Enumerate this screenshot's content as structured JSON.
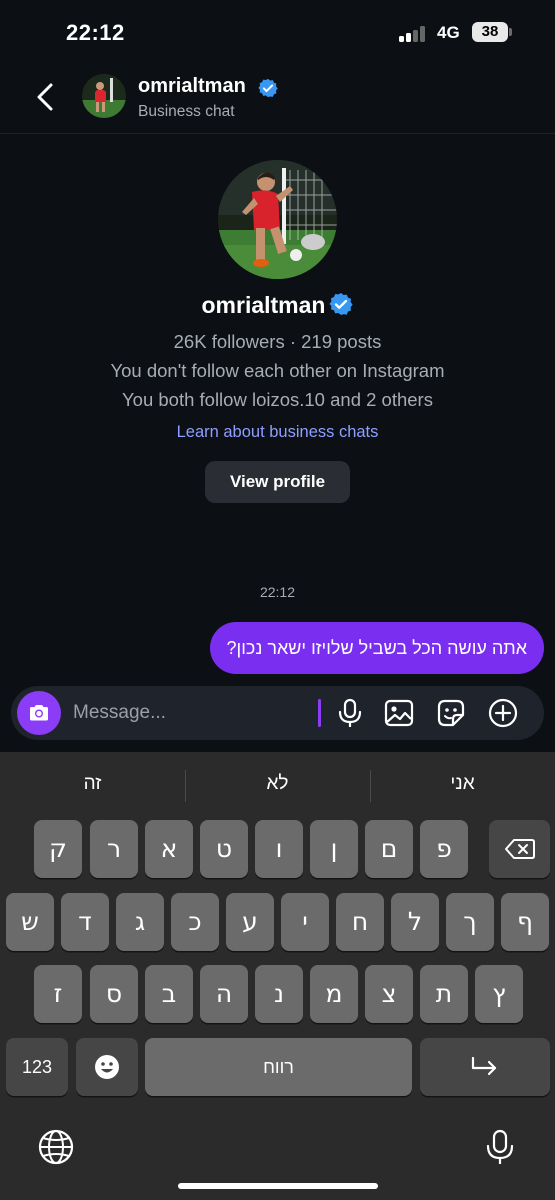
{
  "status_bar": {
    "time": "22:12",
    "network": "4G",
    "battery": "38"
  },
  "header": {
    "username": "omrialtman",
    "subtitle": "Business chat"
  },
  "profile": {
    "username": "omrialtman",
    "stats": "26K followers · 219 posts",
    "follow_status": "You don't follow each other on Instagram",
    "mutual": "You both follow loizos.10 and 2 others",
    "learn_link": "Learn about business chats",
    "view_profile_label": "View profile"
  },
  "messages": [
    {
      "time": "22:12",
      "text": "אתה עושה הכל בשביל שלויזו ישאר נכון?",
      "direction": "outgoing"
    }
  ],
  "composer": {
    "placeholder": "Message..."
  },
  "keyboard": {
    "suggestions": [
      "זה",
      "לא",
      "אני"
    ],
    "row1": [
      "ק",
      "ר",
      "א",
      "ט",
      "ו",
      "ן",
      "ם",
      "פ"
    ],
    "row2": [
      "ש",
      "ד",
      "ג",
      "כ",
      "ע",
      "י",
      "ח",
      "ל",
      "ך",
      "ף"
    ],
    "row3": [
      "ז",
      "ס",
      "ב",
      "ה",
      "נ",
      "מ",
      "צ",
      "ת",
      "ץ"
    ],
    "numbers_label": "123",
    "space_label": "רווח"
  },
  "colors": {
    "accent": "#7a2ff0",
    "background": "#0c0f14",
    "link": "#8f9fff",
    "verified": "#3897f0"
  },
  "icons": [
    "back-chevron-icon",
    "verified-badge-icon",
    "camera-icon",
    "microphone-icon",
    "image-icon",
    "sticker-icon",
    "plus-circle-icon",
    "backspace-icon",
    "emoji-icon",
    "return-icon",
    "globe-icon"
  ]
}
